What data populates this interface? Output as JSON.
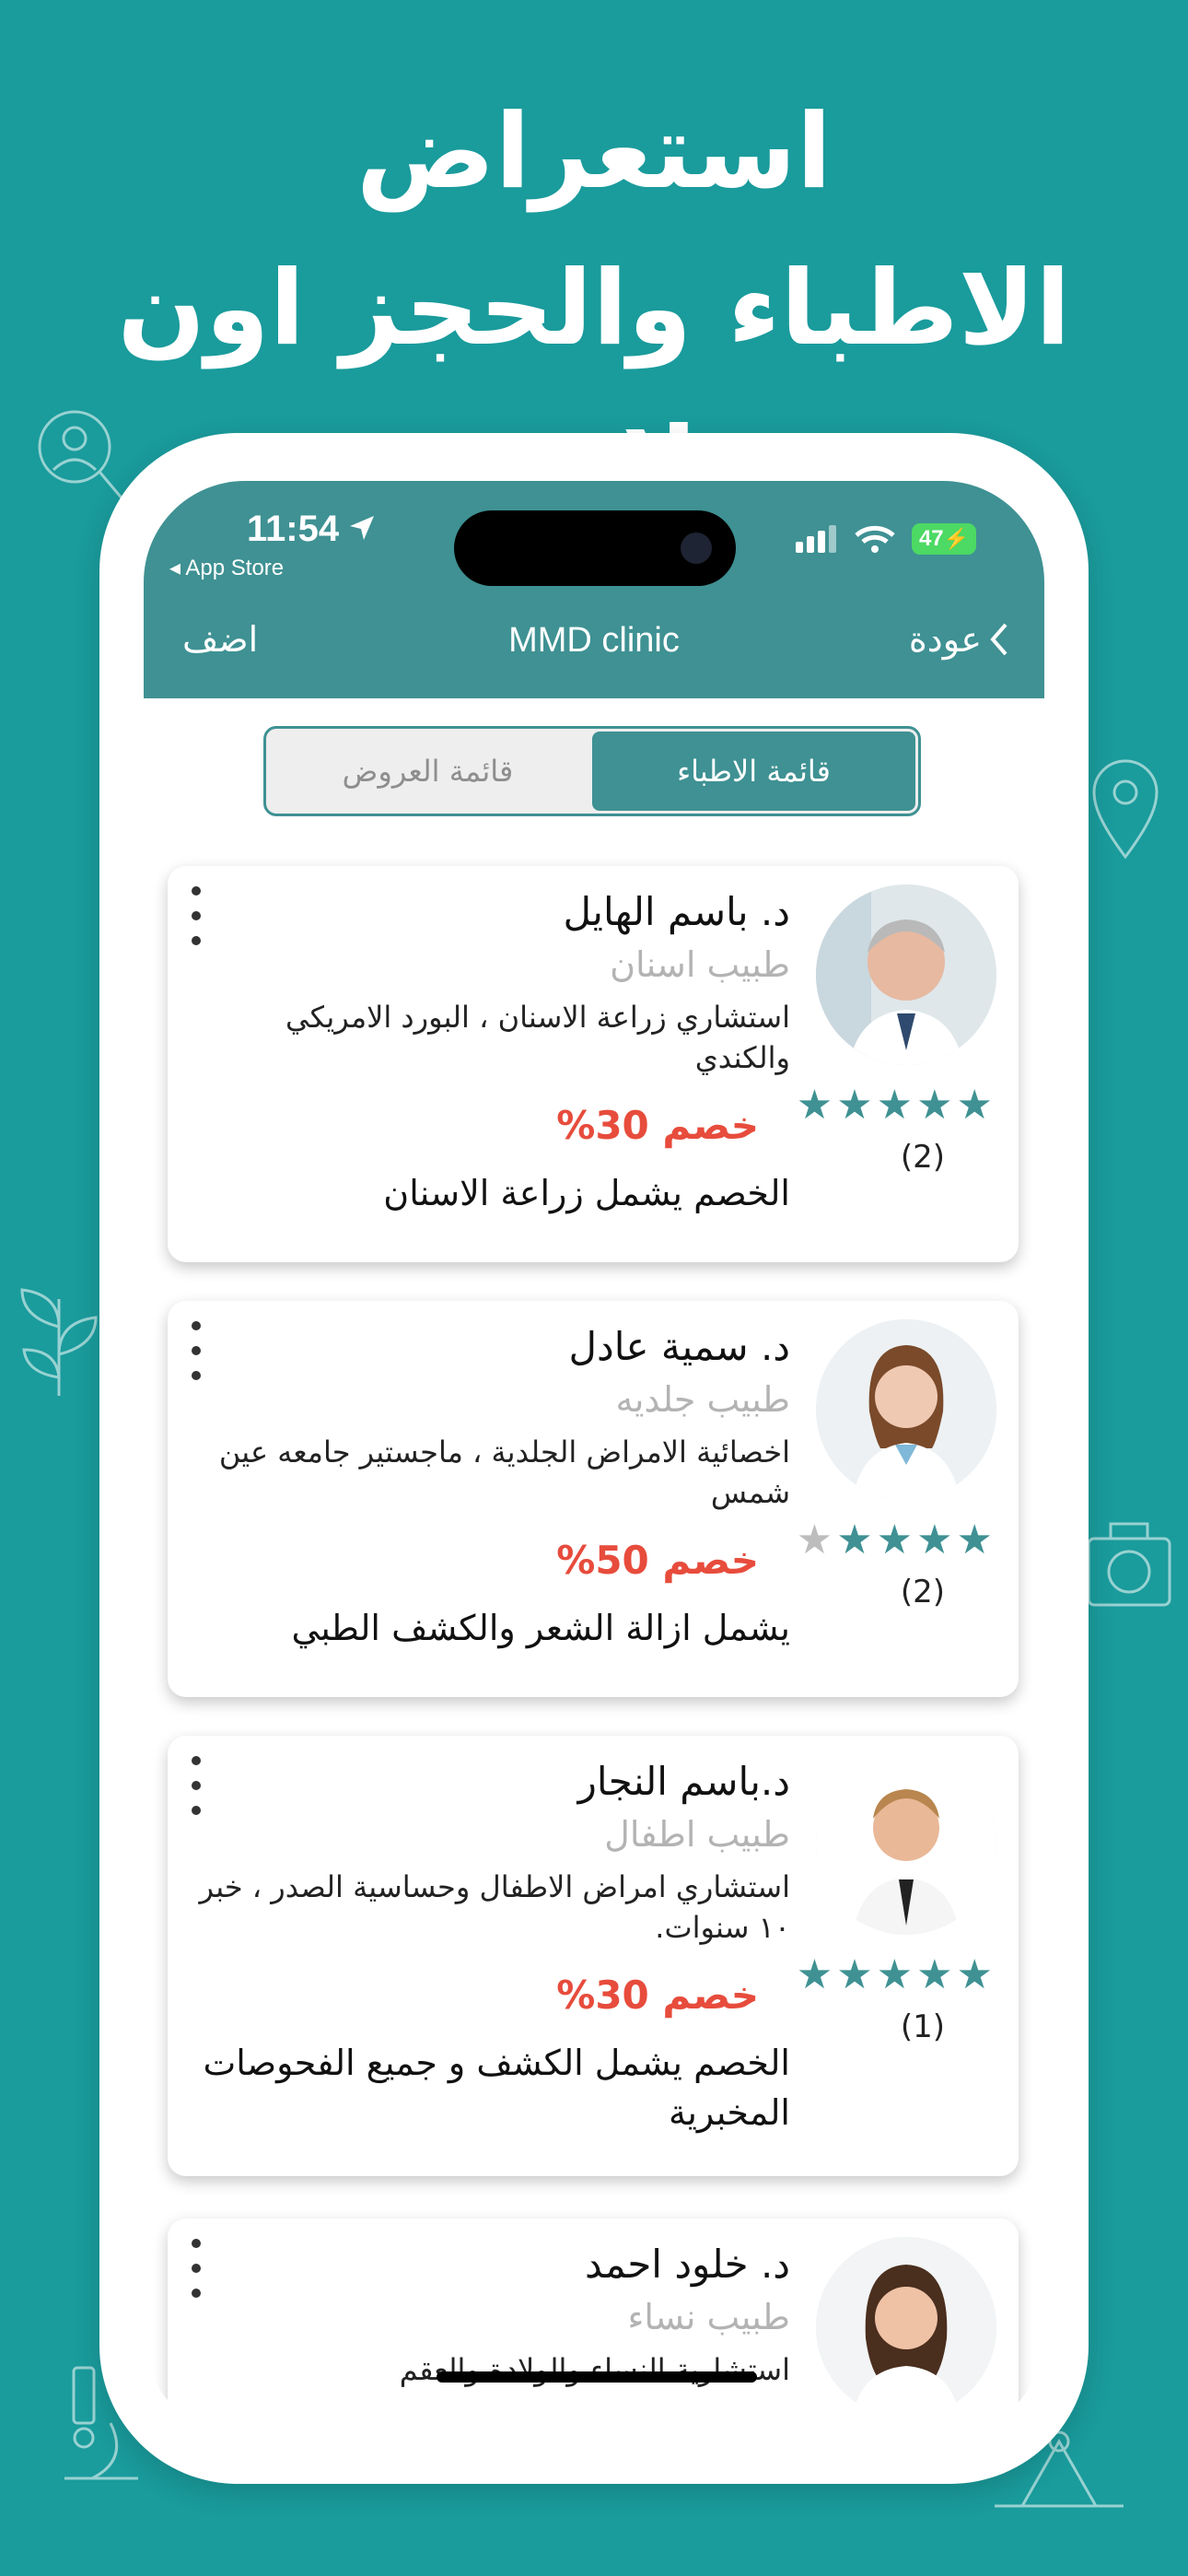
{
  "headline": {
    "line1": "استعراض",
    "line2": "الاطباء والحجز اون لاين"
  },
  "status_bar": {
    "time": "11:54",
    "back_app": "◂ App Store",
    "battery": "47"
  },
  "nav": {
    "title": "MMD clinic",
    "back_label": "عودة",
    "add_label": "اضف"
  },
  "segments": {
    "doctors": "قائمة الاطباء",
    "offers": "قائمة العروض",
    "selected": "doctors"
  },
  "doctors": [
    {
      "name": "د. باسم الهايل",
      "specialty": "طبيب اسنان",
      "description": "استشاري زراعة الاسنان ، البورد الامريكي والكندي",
      "discount": "خصم 30%",
      "note": "الخصم يشمل زراعة الاسنان",
      "rating": 5,
      "review_count": "(2)"
    },
    {
      "name": "د. سمية عادل",
      "specialty": "طبيب جلديه",
      "description": "اخصائية الامراض الجلدية ، ماجستير جامعه عين شمس",
      "discount": "خصم 50%",
      "note": "يشمل ازالة الشعر والكشف الطبي",
      "rating": 4,
      "review_count": "(2)"
    },
    {
      "name": "د.باسم النجار",
      "specialty": "طبيب اطفال",
      "description": "استشاري امراض الاطفال وحساسية الصدر ، خبر ١٠ سنوات.",
      "discount": "خصم 30%",
      "note": "الخصم يشمل الكشف و جميع الفحوصات المخبرية",
      "rating": 5,
      "review_count": "(1)"
    },
    {
      "name": "د. خلود احمد",
      "specialty": "طبيب نساء",
      "description": "استشارية النساء والولادة والعقم",
      "discount": "",
      "note": "",
      "rating": 0,
      "review_count": ""
    }
  ],
  "colors": {
    "background": "#1a9b9c",
    "bar": "#3f9193",
    "discount": "#e74c3c",
    "star": "#3f9193"
  }
}
